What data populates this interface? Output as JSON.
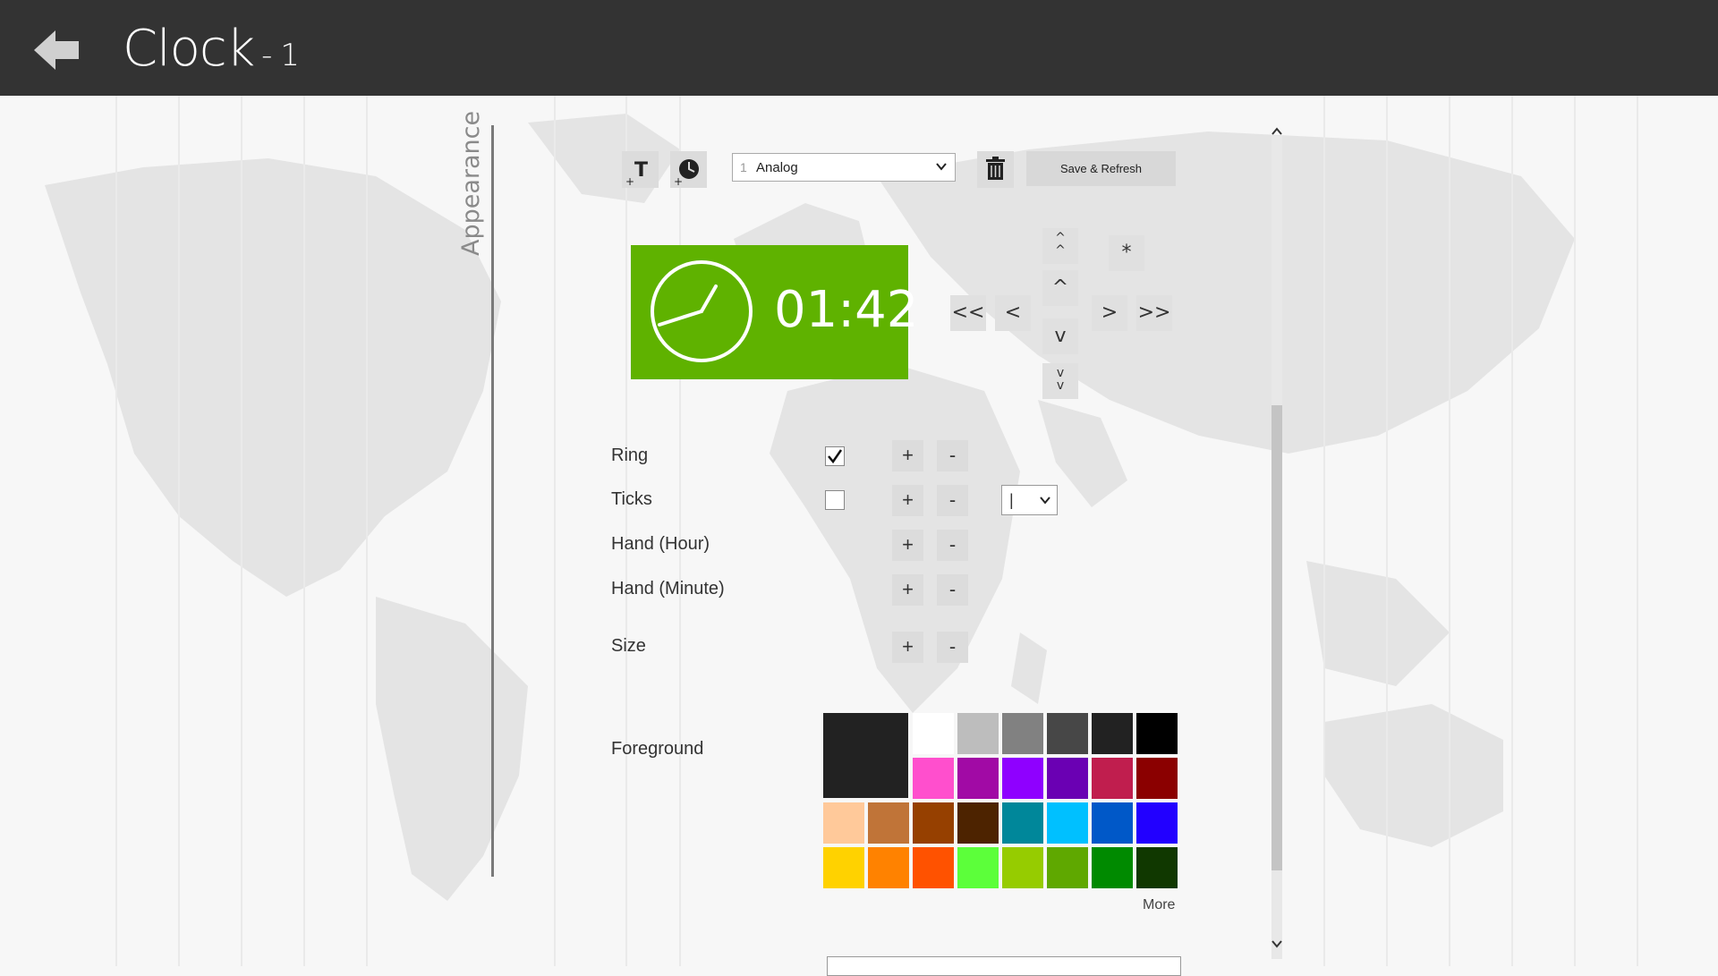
{
  "header": {
    "title": "Clock",
    "subtitle": "- 1"
  },
  "sidebar": {
    "label": "Appearance"
  },
  "toolbar": {
    "select_number": "1",
    "select_value": "Analog",
    "save_label": "Save & Refresh"
  },
  "preview": {
    "time": "01:42",
    "background": "#5fb200"
  },
  "nav": {
    "fast_left": "<<",
    "left": "<",
    "right": ">",
    "fast_right": ">>",
    "up": "^",
    "down": "v",
    "reset": "*"
  },
  "rows": {
    "ring": {
      "label": "Ring",
      "checked": true
    },
    "ticks": {
      "label": "Ticks",
      "checked": false,
      "style_value": "|"
    },
    "hand_hour": {
      "label": "Hand (Hour)"
    },
    "hand_minute": {
      "label": "Hand (Minute)"
    },
    "size": {
      "label": "Size"
    },
    "plus": "+",
    "minus": "-"
  },
  "foreground": {
    "label": "Foreground",
    "selected_color": "#222222",
    "colors": [
      "#ffffff",
      "#bdbdbd",
      "#818181",
      "#474747",
      "#222222",
      "#000000",
      "#ff4fcd",
      "#a10aa5",
      "#8f00ff",
      "#6a00b3",
      "#c01e4e",
      "#8b0000",
      "#ffc99a",
      "#c07438",
      "#964000",
      "#4d2300",
      "#00879a",
      "#00c0ff",
      "#0058c8",
      "#2200ff",
      "#ffd200",
      "#ff8200",
      "#ff5200",
      "#5cff3a",
      "#96cc00",
      "#5fa800",
      "#008a00",
      "#103800"
    ],
    "more_label": "More"
  }
}
